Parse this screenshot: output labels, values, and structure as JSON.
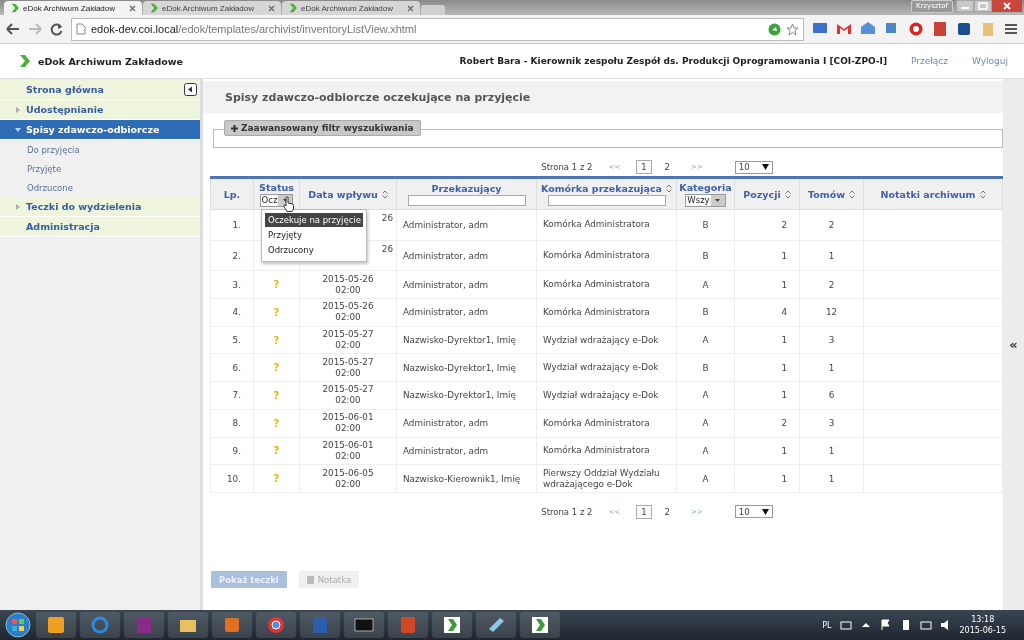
{
  "browser": {
    "tabs": [
      {
        "title": "eDok Archiwum Zakładow",
        "selected": true
      },
      {
        "title": "eDok Archiwum Zakładow",
        "selected": false
      },
      {
        "title": "eDok Archiwum Zakładow",
        "selected": false
      }
    ],
    "profile": "Krzysztof",
    "url_host": "edok-dev.coi.local",
    "url_path": "/edok/templates/archivist/inventoryListView.xhtml"
  },
  "header": {
    "app_title": "eDok Archiwum Zakładowe",
    "user": "Robert Bara - Kierownik zespołu Zespół ds. Produkcji Oprogramowania I [COI-ZPO-I]",
    "links": [
      "Przełącz",
      "Wyloguj"
    ]
  },
  "sidebar": {
    "items": [
      {
        "label": "Strona główna",
        "kind": "plain",
        "selected": false
      },
      {
        "label": "Udostępnianie",
        "kind": "group",
        "expanded": false,
        "selected": false
      },
      {
        "label": "Spisy zdawczo-odbiorcze",
        "kind": "group",
        "expanded": true,
        "selected": true,
        "children": [
          {
            "label": "Do przyjęcia",
            "selected": false
          },
          {
            "label": "Przyjęte",
            "selected": false
          },
          {
            "label": "Odrzucone",
            "selected": false
          }
        ]
      },
      {
        "label": "Teczki do wydzielenia",
        "kind": "group",
        "expanded": false,
        "selected": false
      },
      {
        "label": "Administracja",
        "kind": "plain",
        "selected": false
      }
    ]
  },
  "page": {
    "title": "Spisy zdawczo-odbiorcze oczekujące na przyjęcie",
    "filter_toggle": "Zaawansowany filtr wyszukiwania",
    "paginator_top": {
      "summary": "Strona 1 z 2",
      "prev": "<<",
      "pages": [
        {
          "label": "1",
          "selected": true
        },
        {
          "label": "2",
          "selected": false
        }
      ],
      "next": ">>",
      "page_size": "10"
    },
    "table": {
      "columns": [
        {
          "label": "Lp.",
          "sortable": false,
          "kind": "plain"
        },
        {
          "label": "Status",
          "sortable": false,
          "kind": "select",
          "filter_value": "Ocz"
        },
        {
          "label": "Data wpływu",
          "sortable": true,
          "kind": "plain"
        },
        {
          "label": "Przekazujący",
          "sortable": false,
          "kind": "text"
        },
        {
          "label": "Komórka przekazująca",
          "sortable": true,
          "kind": "text"
        },
        {
          "label": "Kategoria",
          "sortable": false,
          "kind": "select",
          "filter_value": "Wszy"
        },
        {
          "label": "Pozycji",
          "sortable": true,
          "kind": "plain"
        },
        {
          "label": "Tomów",
          "sortable": true,
          "kind": "plain"
        },
        {
          "label": "Notatki archiwum",
          "sortable": true,
          "kind": "plain"
        }
      ],
      "rows": [
        {
          "lp": "1.",
          "date": "26",
          "sender": "Administrator, adm",
          "unit": "Komórka Administratora",
          "category": "B",
          "items": "2",
          "volumes": "2"
        },
        {
          "lp": "2.",
          "date": "26",
          "sender": "Administrator, adm",
          "unit": "Komórka Administratora",
          "category": "B",
          "items": "1",
          "volumes": "1"
        },
        {
          "lp": "3.",
          "status": "?",
          "date": "2015-05-26",
          "time": "02:00",
          "sender": "Administrator, adm",
          "unit": "Komórka Administratora",
          "category": "A",
          "items": "1",
          "volumes": "2"
        },
        {
          "lp": "4.",
          "status": "?",
          "date": "2015-05-26",
          "time": "02:00",
          "sender": "Administrator, adm",
          "unit": "Komórka Administratora",
          "category": "B",
          "items": "4",
          "volumes": "12"
        },
        {
          "lp": "5.",
          "status": "?",
          "date": "2015-05-27",
          "time": "02:00",
          "sender": "Nazwisko-Dyrektor1, Imię",
          "unit": "Wydział wdrażający e-Dok",
          "category": "A",
          "items": "1",
          "volumes": "3"
        },
        {
          "lp": "6.",
          "status": "?",
          "date": "2015-05-27",
          "time": "02:00",
          "sender": "Nazwisko-Dyrektor1, Imię",
          "unit": "Wydział wdrażający e-Dok",
          "category": "B",
          "items": "1",
          "volumes": "1"
        },
        {
          "lp": "7.",
          "status": "?",
          "date": "2015-05-27",
          "time": "02:00",
          "sender": "Nazwisko-Dyrektor1, Imię",
          "unit": "Wydział wdrażający e-Dok",
          "category": "A",
          "items": "1",
          "volumes": "6"
        },
        {
          "lp": "8.",
          "status": "?",
          "date": "2015-06-01",
          "time": "02:00",
          "sender": "Administrator, adm",
          "unit": "Komórka Administratora",
          "category": "A",
          "items": "2",
          "volumes": "3"
        },
        {
          "lp": "9.",
          "status": "?",
          "date": "2015-06-01",
          "time": "02:00",
          "sender": "Administrator, adm",
          "unit": "Komórka Administratora",
          "category": "A",
          "items": "1",
          "volumes": "1"
        },
        {
          "lp": "10.",
          "status": "?",
          "date": "2015-06-05",
          "time": "02:00",
          "sender": "Nazwisko-Kierownik1, Imię",
          "unit": "Pierwszy Oddział Wydziału wdrażającego e-Dok",
          "category": "A",
          "items": "1",
          "volumes": "1"
        }
      ]
    },
    "status_dropdown": {
      "options": [
        {
          "label": "Oczekuje na przyjęcie",
          "selected": true
        },
        {
          "label": "Przyjęty",
          "selected": false
        },
        {
          "label": "Odrzucony",
          "selected": false
        }
      ]
    },
    "paginator_bottom": {
      "summary": "Strona 1 z 2",
      "prev": "<<",
      "pages": [
        {
          "label": "1",
          "selected": true
        },
        {
          "label": "2",
          "selected": false
        }
      ],
      "next": ">>",
      "page_size": "10"
    },
    "buttons": [
      {
        "label": "Pokaż teczki",
        "kind": "primary",
        "disabled": true
      },
      {
        "label": "Notatka",
        "kind": "note",
        "disabled": true
      }
    ],
    "right_panel_toggle": "«"
  },
  "taskbar": {
    "language": "PL",
    "time": "13:18",
    "date": "2015-06-15"
  }
}
